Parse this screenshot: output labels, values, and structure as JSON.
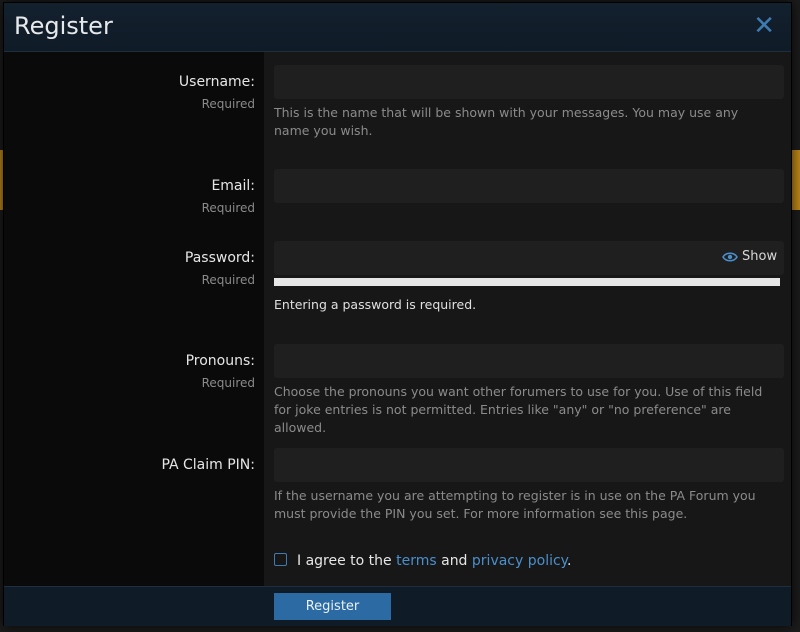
{
  "dialog": {
    "title": "Register",
    "close_glyph": "✕"
  },
  "form": {
    "username": {
      "label": "Username:",
      "required": "Required",
      "value": "",
      "help": "This is the name that will be shown with your messages. You may use any name you wish."
    },
    "email": {
      "label": "Email:",
      "required": "Required",
      "value": ""
    },
    "password": {
      "label": "Password:",
      "required": "Required",
      "value": "",
      "show_label": "Show",
      "strength_fraction": 1.0,
      "message": "Entering a password is required."
    },
    "pronouns": {
      "label": "Pronouns:",
      "required": "Required",
      "value": "",
      "help": "Choose the pronouns you want other forumers to use for you. Use of this field for joke entries is not permitted. Entries like \"any\" or \"no preference\" are allowed."
    },
    "pin": {
      "label": "PA Claim PIN:",
      "value": "",
      "help": "If the username you are attempting to register is in use on the PA Forum you must provide the PIN you set. For more information see this page."
    },
    "agree": {
      "prefix": "I agree to the",
      "terms": "terms",
      "and": "and",
      "privacy": "privacy policy",
      "suffix": "."
    }
  },
  "footer": {
    "register_label": "Register"
  },
  "colors": {
    "accent": "#2c6aa3",
    "link": "#4a8fcc",
    "titlebar": "#13202d"
  },
  "icons": {
    "close": "close-icon",
    "show": "eye-icon"
  }
}
